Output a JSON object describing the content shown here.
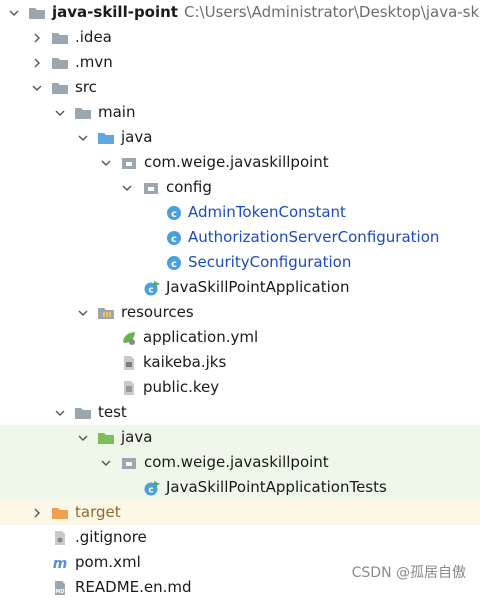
{
  "project": {
    "name": "java-skill-point",
    "path": "C:\\Users\\Administrator\\Desktop\\java-skill-"
  },
  "idea": ".idea",
  "mvn": ".mvn",
  "src": "src",
  "main": "main",
  "main_java": "java",
  "main_package": "com.weige.javaskillpoint",
  "config": "config",
  "classes": {
    "admin_token": "AdminTokenConstant",
    "auth_server": "AuthorizationServerConfiguration",
    "security": "SecurityConfiguration"
  },
  "app_class": "JavaSkillPointApplication",
  "resources": "resources",
  "application_yml": "application.yml",
  "kaikeba_jks": "kaikeba.jks",
  "public_key": "public.key",
  "test": "test",
  "test_java": "java",
  "test_package": "com.weige.javaskillpoint",
  "test_class": "JavaSkillPointApplicationTests",
  "target": "target",
  "gitignore": ".gitignore",
  "pom": "pom.xml",
  "readme": "README.en.md",
  "watermark": "CSDN @孤居自傲"
}
